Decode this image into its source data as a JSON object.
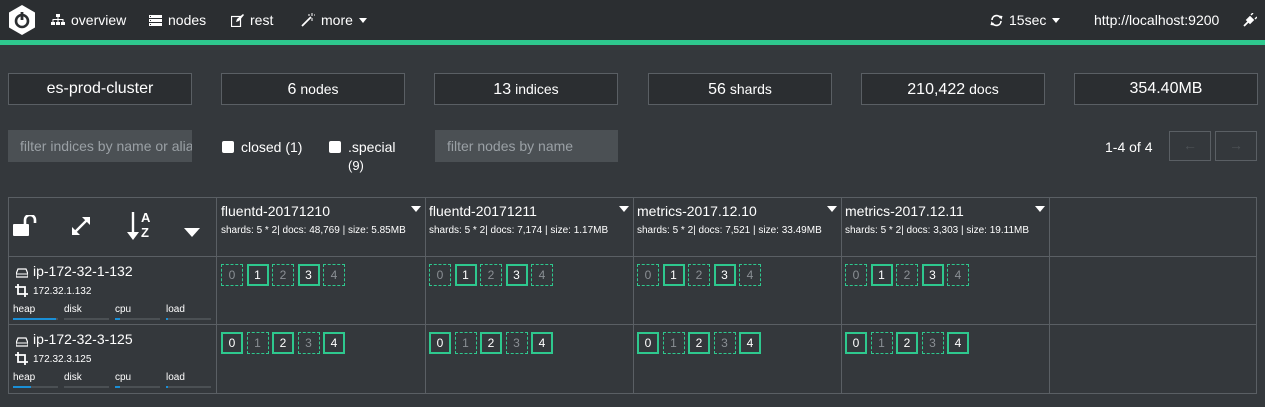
{
  "nav": {
    "overview": "overview",
    "nodes": "nodes",
    "rest": "rest",
    "more": "more",
    "refresh": "15sec",
    "host": "http://localhost:9200"
  },
  "stats": {
    "cluster": "es-prod-cluster",
    "nodes_value": "6",
    "nodes_label": "nodes",
    "indices_value": "13",
    "indices_label": "indices",
    "shards_value": "56",
    "shards_label": "shards",
    "docs_value": "210,422",
    "docs_label": "docs",
    "size": "354.40MB"
  },
  "filters": {
    "indices_placeholder": "filter indices by name or aliases",
    "closed_label": "closed (1)",
    "special_label": ".special",
    "special_count": "(9)",
    "nodes_placeholder": "filter nodes by name",
    "pagination": "1-4 of 4",
    "prev": "←",
    "next": "→"
  },
  "sort_az": "A",
  "sort_z": "Z",
  "indices": [
    {
      "name": "fluentd-20171210",
      "stats": "shards: 5 * 2| docs: 48,769 | size: 5.85MB"
    },
    {
      "name": "fluentd-20171211",
      "stats": "shards: 5 * 2| docs: 7,174 | size: 1.17MB"
    },
    {
      "name": "metrics-2017.12.10",
      "stats": "shards: 5 * 2| docs: 7,521 | size: 33.49MB"
    },
    {
      "name": "metrics-2017.12.11",
      "stats": "shards: 5 * 2| docs: 3,303 | size: 19.11MB"
    }
  ],
  "nodes": [
    {
      "name": "ip-172-32-1-132",
      "ip": "172.32.1.132",
      "heap": "heap",
      "disk": "disk",
      "cpu": "cpu",
      "load": "load",
      "heap_fill": 0.95,
      "cpu_fill": 0.1,
      "load_fill": 0.05
    },
    {
      "name": "ip-172-32-3-125",
      "ip": "172.32.3.125",
      "heap": "heap",
      "disk": "disk",
      "cpu": "cpu",
      "load": "load",
      "heap_fill": 0.4,
      "cpu_fill": 0.1,
      "load_fill": 0.05
    }
  ],
  "shard_numbers": [
    "0",
    "1",
    "2",
    "3",
    "4"
  ],
  "shard_rows": [
    [
      "replica",
      "primary",
      "replica",
      "primary",
      "replica"
    ],
    [
      "primary",
      "replica",
      "primary",
      "replica",
      "primary"
    ]
  ],
  "colors": {
    "accent": "#2ec88e",
    "background": "#34383c",
    "navbar": "#2b2e31",
    "heap_bar": "#1a8fd6"
  }
}
